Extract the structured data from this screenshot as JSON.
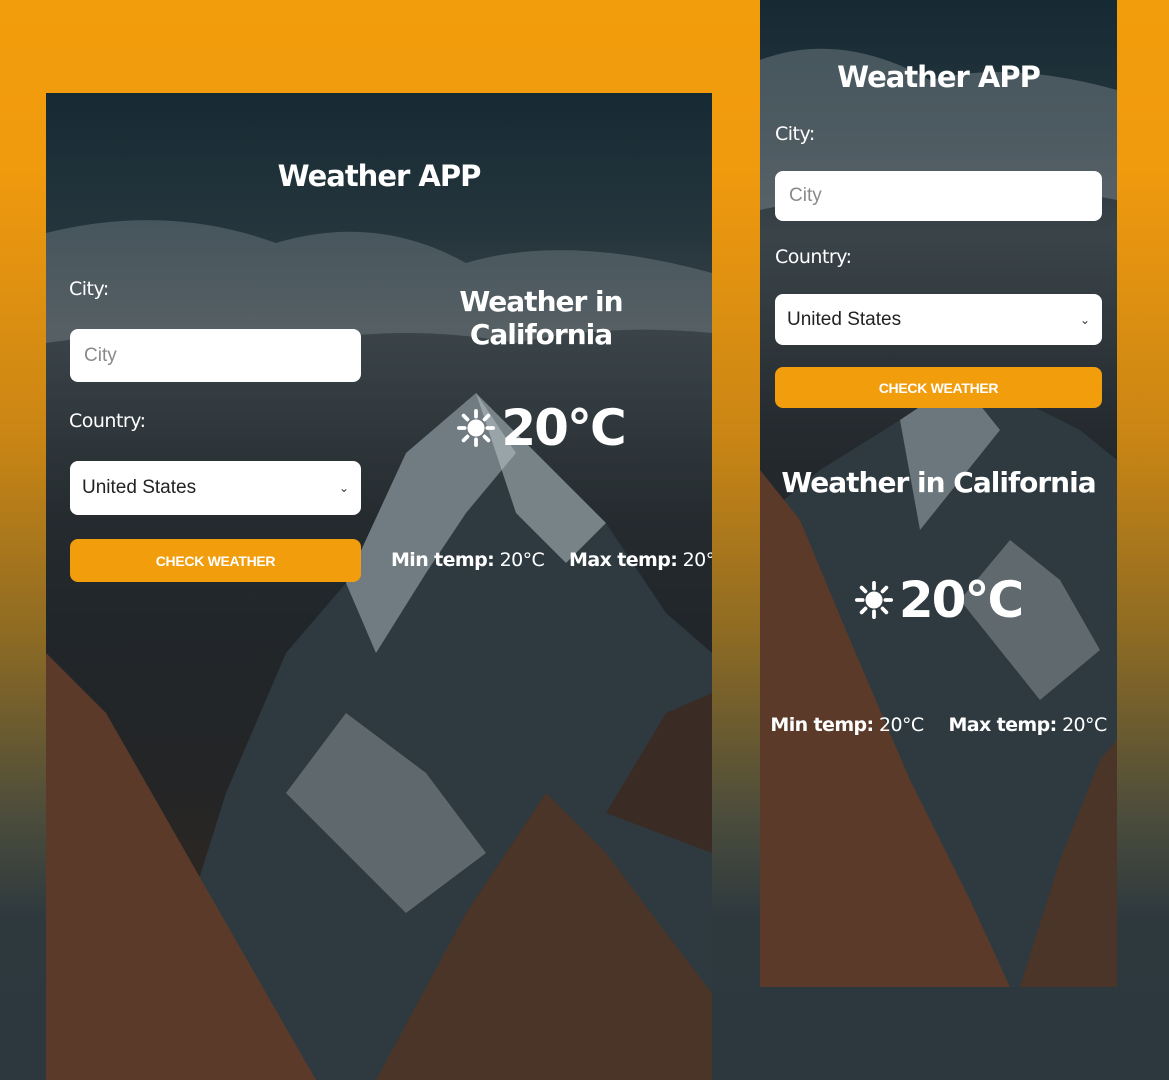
{
  "app": {
    "title": "Weather APP",
    "colors": {
      "accent": "#f29d0c",
      "page_top": "#f29d0c",
      "page_bottom": "#2c383e"
    }
  },
  "form": {
    "city_label": "City:",
    "city_placeholder": "City",
    "city_value": "",
    "country_label": "Country:",
    "country_selected": "United States",
    "button_label": "CHECK WEATHER"
  },
  "weather": {
    "heading": "Weather in California",
    "icon": "sun-icon",
    "temperature": "20°C",
    "min_label": "Min temp:",
    "min_value": "20°C",
    "max_label": "Max temp:",
    "max_value": "20°C"
  }
}
